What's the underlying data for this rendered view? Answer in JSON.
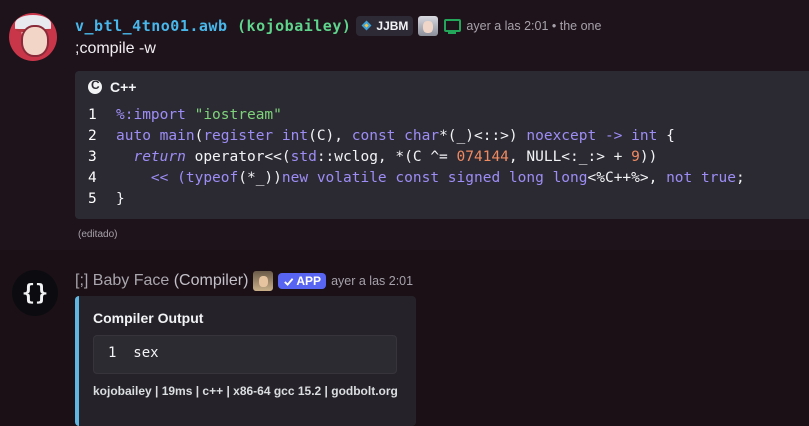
{
  "message1": {
    "username_part1": "v_btl_4tno01.awb",
    "username_part2": " (kojobailey)",
    "server_tag": "JJBM",
    "timestamp": "ayer a las 2:01",
    "timestamp_suffix": " • the one",
    "content": ";compile -w",
    "edited": "(editado)",
    "codeblock": {
      "language": "C++",
      "line_numbers": [
        "1",
        "2",
        "3",
        "4",
        "5"
      ]
    }
  },
  "message2": {
    "username_prefix": "[;] Baby Face ",
    "username_suffix": "(Compiler)",
    "avatar_glyph": "{}",
    "app_badge": "APP",
    "timestamp": "ayer a las 2:01",
    "embed": {
      "title": "Compiler Output",
      "output": "1  sex",
      "footer": "kojobailey | 19ms | c++ | x86-64 gcc 15.2 | godbolt.org"
    }
  },
  "colors": {
    "username": "#48b8ec",
    "keyword": "#9d8df5",
    "string": "#7ed37a",
    "number": "#f08a61",
    "embed_border": "#5fb6e0",
    "app_badge": "#5865f2",
    "status_online": "#23a55a"
  },
  "icons": [
    "server-tag-icon",
    "desktop-status-icon",
    "c-language-icon",
    "checkmark-icon"
  ]
}
